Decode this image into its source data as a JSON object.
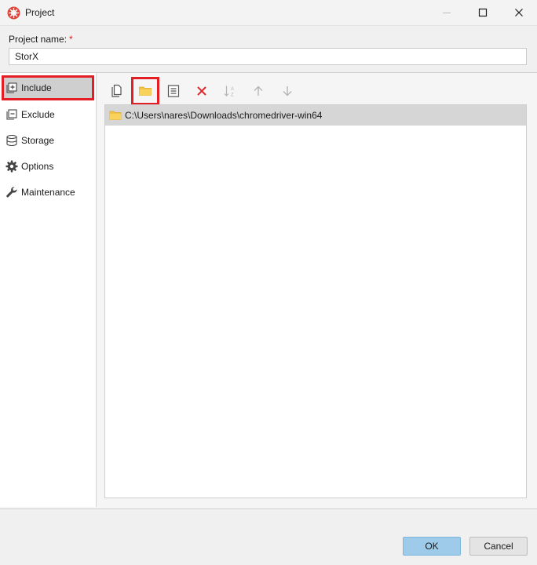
{
  "window": {
    "title": "Project",
    "app_icon": "storx-logo-icon",
    "controls": [
      "minimize-icon",
      "maximize-icon",
      "close-icon"
    ]
  },
  "project_name": {
    "label": "Project name:",
    "required_marker": "*",
    "value": "StorX"
  },
  "sidebar": {
    "items": [
      {
        "label": "Include",
        "icon": "include-icon",
        "selected": true
      },
      {
        "label": "Exclude",
        "icon": "exclude-icon",
        "selected": false
      },
      {
        "label": "Storage",
        "icon": "database-icon",
        "selected": false
      },
      {
        "label": "Options",
        "icon": "gear-icon",
        "selected": false
      },
      {
        "label": "Maintenance",
        "icon": "wrench-icon",
        "selected": false
      }
    ]
  },
  "toolbar": {
    "buttons": [
      {
        "icon": "add-files-icon",
        "enabled": true
      },
      {
        "icon": "add-folder-icon",
        "enabled": true,
        "highlighted": true
      },
      {
        "icon": "list-icon",
        "enabled": true
      },
      {
        "icon": "delete-icon",
        "enabled": true
      },
      {
        "icon": "sort-az-icon",
        "enabled": false
      },
      {
        "icon": "arrow-up-icon",
        "enabled": false
      },
      {
        "icon": "arrow-down-icon",
        "enabled": false
      }
    ]
  },
  "include_list": {
    "items": [
      {
        "path": "C:\\Users\\nares\\Downloads\\chromedriver-win64",
        "icon": "folder-icon"
      }
    ]
  },
  "buttons": {
    "ok": "OK",
    "cancel": "Cancel"
  },
  "colors": {
    "highlight": "#e31e24",
    "ok_button": "#9dcbe9",
    "folder": "#f5c342",
    "delete": "#e0262b"
  }
}
